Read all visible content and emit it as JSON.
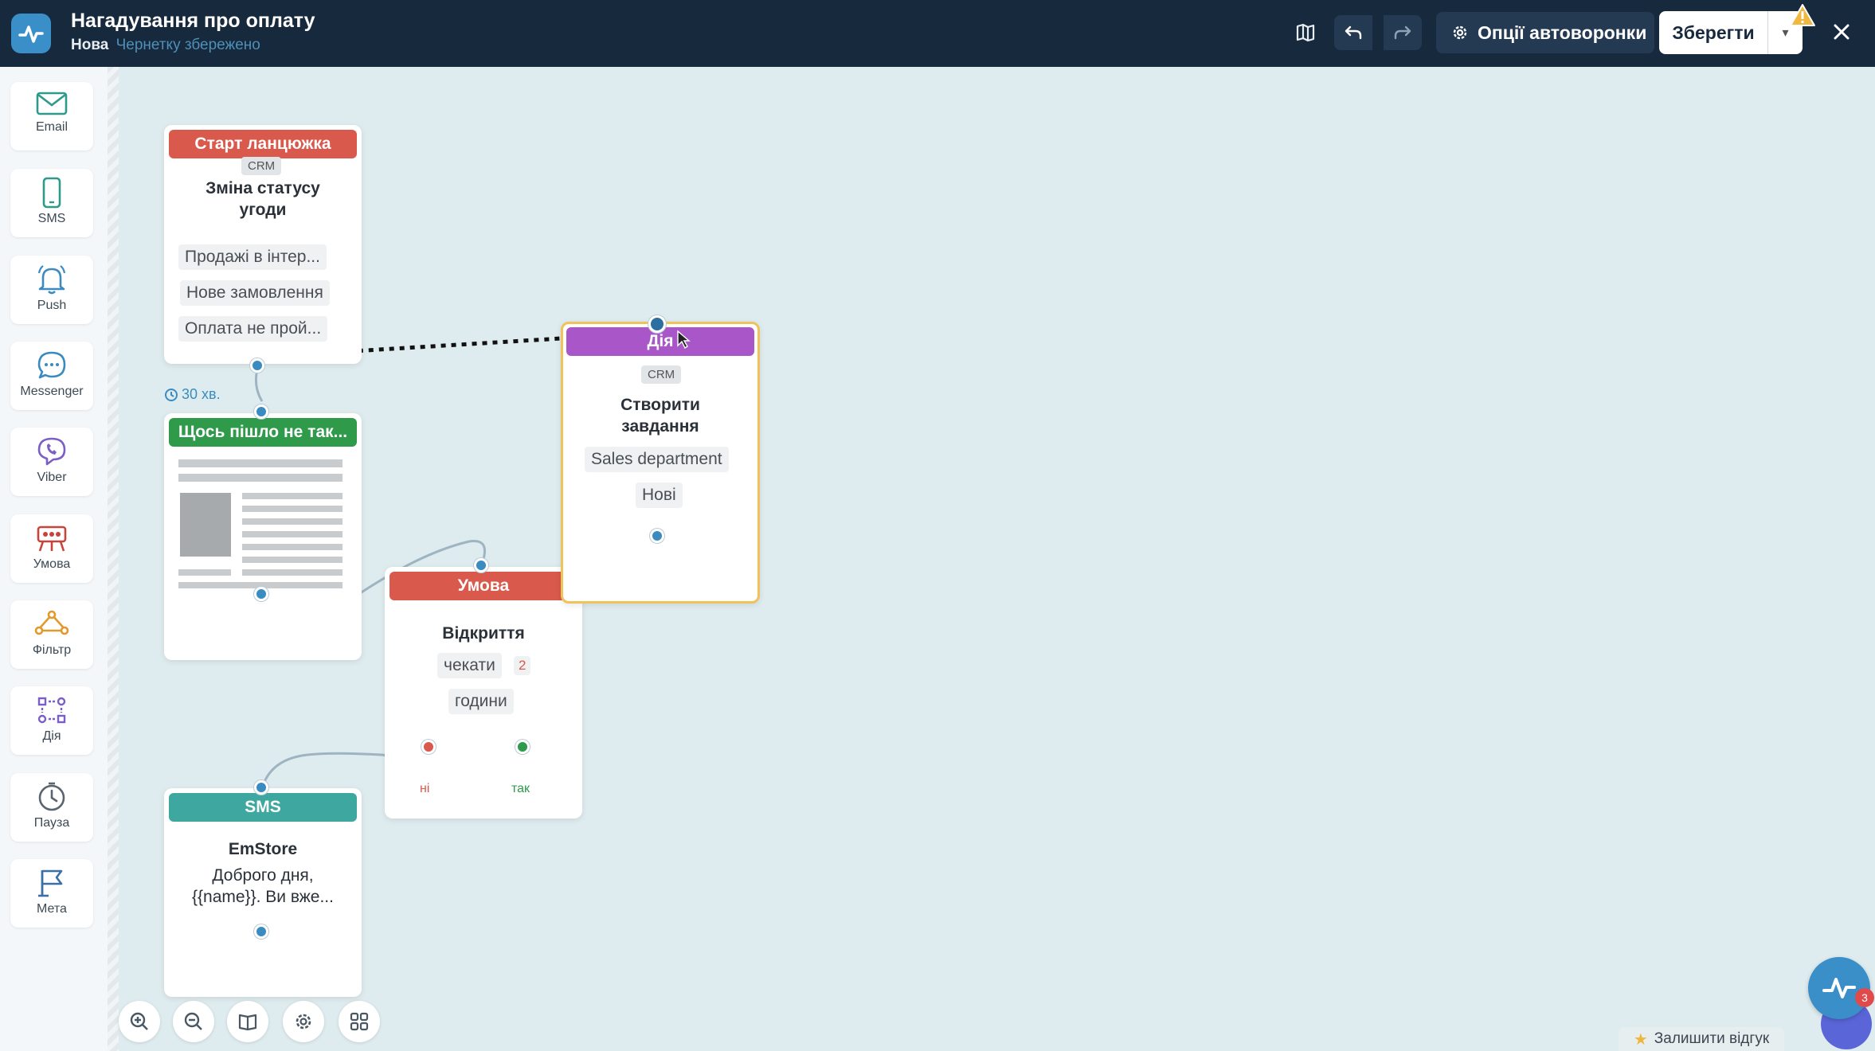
{
  "topbar": {
    "title": "Нагадування про оплату",
    "status": "Нова",
    "saved": "Чернетку збережено",
    "options_label": "Опції автоворонки",
    "save_label": "Зберегти"
  },
  "sidebar": {
    "items": [
      {
        "label": "Email",
        "icon": "envelope-icon",
        "color": "#2e9a8a"
      },
      {
        "label": "SMS",
        "icon": "phone-icon",
        "color": "#2e9a8a"
      },
      {
        "label": "Push",
        "icon": "bell-icon",
        "color": "#3a8bc0"
      },
      {
        "label": "Messenger",
        "icon": "messenger-icon",
        "color": "#3a8bc0"
      },
      {
        "label": "Viber",
        "icon": "viber-icon",
        "color": "#7b5ec6"
      },
      {
        "label": "Умова",
        "icon": "condition-icon",
        "color": "#c7443a"
      },
      {
        "label": "Фільтр",
        "icon": "filter-icon",
        "color": "#e29a2a"
      },
      {
        "label": "Дія",
        "icon": "action-icon",
        "color": "#7b5ec6"
      },
      {
        "label": "Пауза",
        "icon": "clock-icon",
        "color": "#5a6570"
      },
      {
        "label": "Мета",
        "icon": "flag-icon",
        "color": "#3a6fa8"
      }
    ]
  },
  "nodes": {
    "start": {
      "header": "Старт ланцюжка",
      "tag": "CRM",
      "title_line1": "Зміна статусу",
      "title_line2": "угоди",
      "chips": [
        "Продажі в інтер...",
        "Нове замовлення",
        "Оплата не прой..."
      ],
      "color": "#d9594c"
    },
    "delay": {
      "label": "30 хв."
    },
    "email": {
      "header": "Щось пішло не так...",
      "color": "#2e9a4a"
    },
    "condition": {
      "header": "Умова",
      "title": "Відкриття",
      "chip_wait": "чекати",
      "wait_count": "2",
      "chip_hours": "години",
      "no_label": "ні",
      "yes_label": "так",
      "color": "#d9594c"
    },
    "action": {
      "header": "Дія",
      "tag": "CRM",
      "title_line1": "Створити",
      "title_line2": "завдання",
      "chips": [
        "Sales department",
        "Нові"
      ],
      "color": "#a957c8"
    },
    "sms": {
      "header": "SMS",
      "title": "EmStore",
      "text_line1": "Доброго дня,",
      "text_line2": "{{name}}. Ви вже...",
      "color": "#3ea8a0"
    }
  },
  "footer": {
    "feedback": "Залишити відгук",
    "badge": "3"
  }
}
